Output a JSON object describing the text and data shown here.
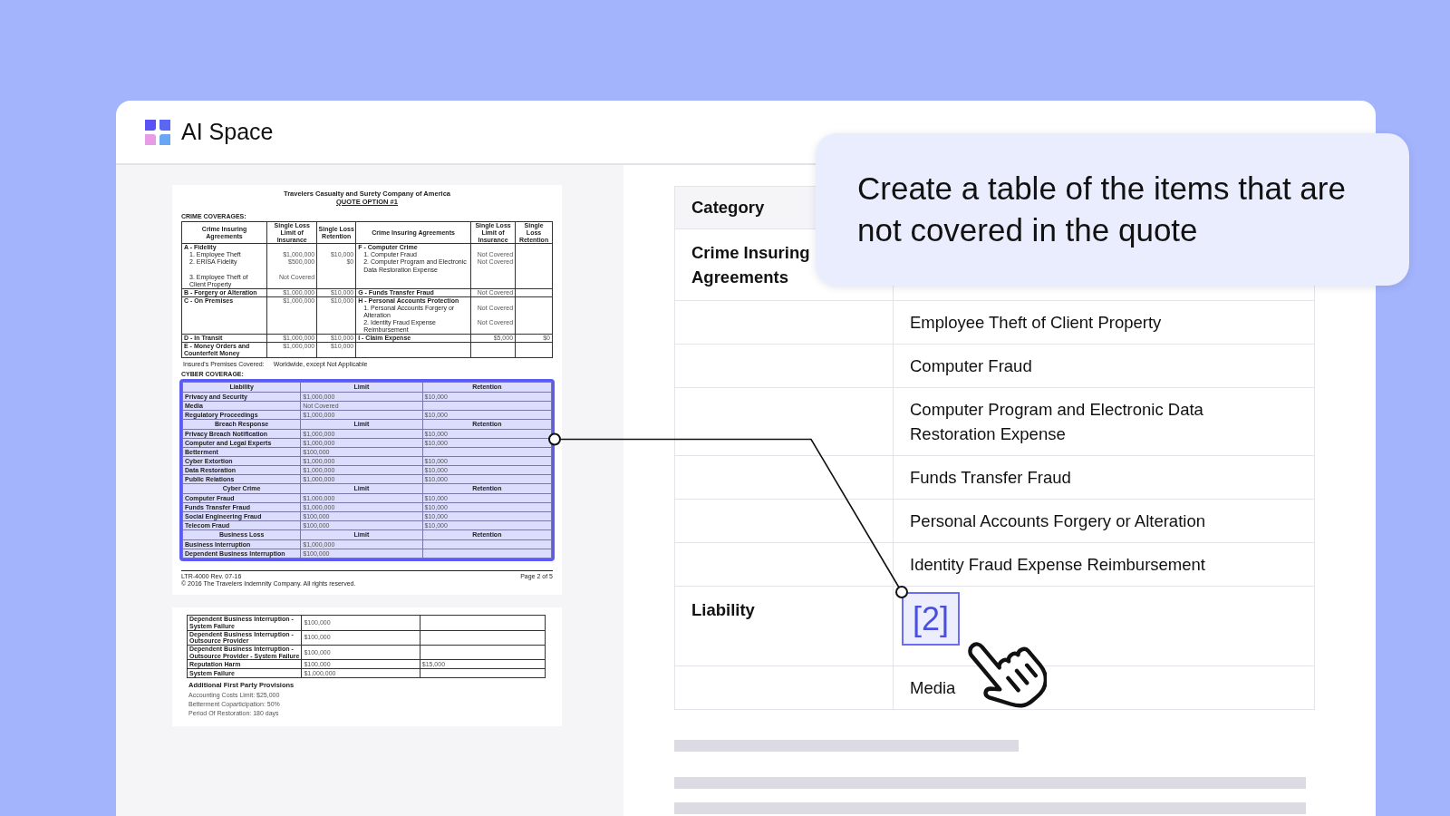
{
  "app": {
    "name": "AI Space"
  },
  "document": {
    "title": "Travelers Casualty and Surety Company of America",
    "subtitle": "QUOTE OPTION #1",
    "crime_heading": "CRIME COVERAGES:",
    "crime_columns": [
      "Crime Insuring Agreements",
      "Single Loss Limit of Insurance",
      "Single Loss Retention",
      "Crime Insuring Agreements",
      "Single Loss Limit of Insurance",
      "Single Loss Retention"
    ],
    "crime_rows": [
      {
        "kind": "head",
        "cells": [
          "A - Fidelity",
          null,
          null,
          "F - Computer Crime",
          null,
          null
        ]
      },
      {
        "kind": "sub",
        "cells": [
          "1. Employee Theft",
          "$1,000,000",
          "$10,000",
          "1. Computer Fraud",
          "Not Covered",
          null
        ]
      },
      {
        "kind": "sub",
        "cells": [
          "2. ERISA Fidelity",
          "$500,000",
          "$0",
          "2. Computer Program and Electronic Data Restoration Expense",
          "Not Covered",
          null
        ]
      },
      {
        "kind": "sub",
        "cells": [
          "3. Employee Theft of Client Property",
          "Not Covered",
          null,
          null,
          null,
          null
        ]
      },
      {
        "kind": "head",
        "cells": [
          "B - Forgery or Alteration",
          "$1,000,000",
          "$10,000",
          "G - Funds Transfer Fraud",
          "Not Covered",
          null
        ]
      },
      {
        "kind": "head",
        "cells": [
          "C - On Premises",
          "$1,000,000",
          "$10,000",
          "H - Personal Accounts Protection",
          null,
          null
        ]
      },
      {
        "kind": "sub",
        "cells": [
          null,
          null,
          null,
          "1. Personal Accounts Forgery or Alteration",
          "Not Covered",
          null
        ]
      },
      {
        "kind": "sub",
        "cells": [
          null,
          null,
          null,
          "2. Identity Fraud Expense Reimbursement",
          "Not Covered",
          null
        ]
      },
      {
        "kind": "head",
        "cells": [
          "D - In Transit",
          "$1,000,000",
          "$10,000",
          "I - Claim Expense",
          "$5,000",
          "$0"
        ]
      },
      {
        "kind": "head",
        "cells": [
          "E - Money Orders and Counterfeit Money",
          "$1,000,000",
          "$10,000",
          null,
          null,
          null
        ]
      }
    ],
    "premises_label": "Insured's Premises Covered:",
    "premises_value": "Worldwide, except Not Applicable",
    "cyber_heading": "CYBER COVERAGE:",
    "cyber_table": {
      "highlighted": true,
      "sections": [
        {
          "header": [
            "Liability",
            "Limit",
            "Retention"
          ],
          "rows": [
            [
              "Privacy and Security",
              "$1,000,000",
              "$10,000"
            ],
            [
              "Media",
              "Not Covered",
              null
            ],
            [
              "Regulatory Proceedings",
              "$1,000,000",
              "$10,000"
            ]
          ]
        },
        {
          "header": [
            "Breach Response",
            "Limit",
            "Retention"
          ],
          "rows": [
            [
              "Privacy Breach Notification",
              "$1,000,000",
              "$10,000"
            ],
            [
              "Computer and Legal Experts",
              "$1,000,000",
              "$10,000"
            ],
            [
              "Betterment",
              "$100,000",
              null
            ],
            [
              "Cyber Extortion",
              "$1,000,000",
              "$10,000"
            ],
            [
              "Data Restoration",
              "$1,000,000",
              "$10,000"
            ],
            [
              "Public Relations",
              "$1,000,000",
              "$10,000"
            ]
          ]
        },
        {
          "header": [
            "Cyber Crime",
            "Limit",
            "Retention"
          ],
          "rows": [
            [
              "Computer Fraud",
              "$1,000,000",
              "$10,000"
            ],
            [
              "Funds Transfer Fraud",
              "$1,000,000",
              "$10,000"
            ],
            [
              "Social Engineering Fraud",
              "$100,000",
              "$10,000"
            ],
            [
              "Telecom Fraud",
              "$100,000",
              "$10,000"
            ]
          ]
        },
        {
          "header": [
            "Business Loss",
            "Limit",
            "Retention"
          ],
          "rows": [
            [
              "Business Interruption",
              "$1,000,000",
              null
            ],
            [
              "Dependent Business Interruption",
              "$100,000",
              null
            ]
          ]
        }
      ]
    },
    "footer": {
      "form": "LTR-4000 Rev. 07-16",
      "copyright": "© 2016 The Travelers Indemnity Company.  All rights reserved.",
      "page": "Page 2 of 5"
    },
    "next_page": {
      "rows": [
        [
          "Dependent Business Interruption - System Failure",
          "$100,000",
          null
        ],
        [
          "Dependent Business Interruption - Outsource Provider",
          "$100,000",
          null
        ],
        [
          "Dependent Business Interruption - Outsource Provider - System Failure",
          "$100,000",
          null
        ],
        [
          "Reputation Harm",
          "$100,000",
          "$15,000"
        ],
        [
          "System Failure",
          "$1,000,000",
          null
        ]
      ],
      "provisions_heading": "Additional First Party Provisions",
      "provisions": [
        "Accounting Costs Limit: $25,000",
        "Betterment Coparticipation: 50%",
        "Period Of Restoration: 180 days"
      ]
    }
  },
  "prompt": {
    "text": "Create a table of the items that are not covered in the quote"
  },
  "result_table": {
    "columns": [
      "Category"
    ],
    "rows": [
      {
        "category": "Crime Insuring Agreements"
      },
      {
        "item": "Employee Theft of Client Property"
      },
      {
        "item": "Computer Fraud"
      },
      {
        "item": "Computer Program and Electronic Data Restoration Expense"
      },
      {
        "item": "Funds Transfer Fraud"
      },
      {
        "item": "Personal Accounts Forgery or Alteration"
      },
      {
        "item": "Identity Fraud Expense Reimbursement"
      },
      {
        "category": "Liability",
        "citation": "[2]"
      },
      {
        "item": "Media"
      }
    ]
  }
}
